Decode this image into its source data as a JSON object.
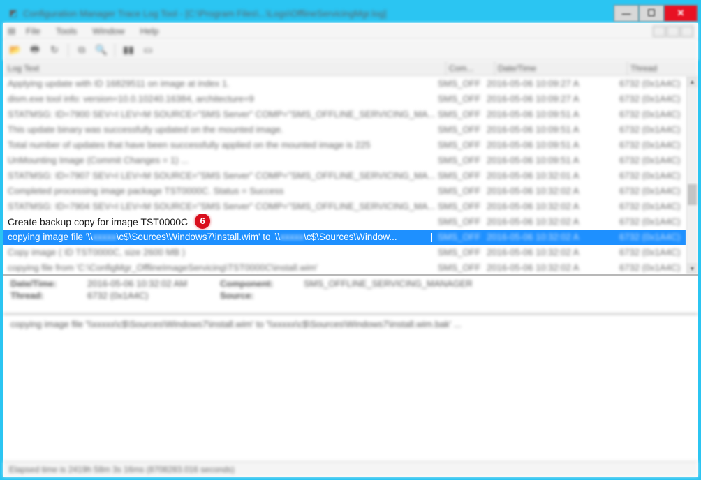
{
  "window": {
    "title": "Configuration Manager Trace Log Tool - [C:\\Program Files\\...\\Logs\\OfflineServicingMgr.log]"
  },
  "menu": {
    "file": "File",
    "tools": "Tools",
    "window": "Window",
    "help": "Help"
  },
  "columns": {
    "logtext": "Log Text",
    "comp": "Com...",
    "datetime": "Date/Time",
    "thread": "Thread"
  },
  "badge": "6",
  "rows": [
    {
      "text": "Applying update with ID 16829511 on image at index 1.",
      "comp": "SMS_OFF",
      "dt": "2016-05-06 10:09:27 A",
      "thread": "6732 (0x1A4C)",
      "cls": "blur"
    },
    {
      "text": "dism.exe tool info: version=10.0.10240.16384, architecture=9",
      "comp": "SMS_OFF",
      "dt": "2016-05-06 10:09:27 A",
      "thread": "6732 (0x1A4C)",
      "cls": "blur"
    },
    {
      "text": "STATMSG: ID=7900 SEV=I LEV=M SOURCE=\"SMS Server\" COMP=\"SMS_OFFLINE_SERVICING_MA...",
      "comp": "SMS_OFF",
      "dt": "2016-05-06 10:09:51 A",
      "thread": "6732 (0x1A4C)",
      "cls": "blur"
    },
    {
      "text": "This update binary was successfully updated on the mounted image.",
      "comp": "SMS_OFF",
      "dt": "2016-05-06 10:09:51 A",
      "thread": "6732 (0x1A4C)",
      "cls": "blur"
    },
    {
      "text": "Total number of updates that have been successfully applied on the mounted image is 225",
      "comp": "SMS_OFF",
      "dt": "2016-05-06 10:09:51 A",
      "thread": "6732 (0x1A4C)",
      "cls": "blur"
    },
    {
      "text": "UnMounting Image (Commit Changes = 1) ...",
      "comp": "SMS_OFF",
      "dt": "2016-05-06 10:09:51 A",
      "thread": "6732 (0x1A4C)",
      "cls": "blur"
    },
    {
      "text": "STATMSG: ID=7907 SEV=I LEV=M SOURCE=\"SMS Server\" COMP=\"SMS_OFFLINE_SERVICING_MA...",
      "comp": "SMS_OFF",
      "dt": "2016-05-06 10:32:01 A",
      "thread": "6732 (0x1A4C)",
      "cls": "blur"
    },
    {
      "text": "Completed processing image package TST0000C. Status = Success",
      "comp": "SMS_OFF",
      "dt": "2016-05-06 10:32:02 A",
      "thread": "6732 (0x1A4C)",
      "cls": "blur"
    },
    {
      "text": "STATMSG: ID=7904 SEV=I LEV=M SOURCE=\"SMS Server\" COMP=\"SMS_OFFLINE_SERVICING_MA...",
      "comp": "SMS_OFF",
      "dt": "2016-05-06 10:32:02 A",
      "thread": "6732 (0x1A4C)",
      "cls": "blur"
    },
    {
      "text": "Create backup copy for image TST0000C",
      "comp": "SMS_OFF",
      "dt": "2016-05-06 10:32:02 A",
      "thread": "6732 (0x1A4C)",
      "cls": "sharp1",
      "badge": true
    },
    {
      "text_parts": {
        "p1": "copying image file '\\\\",
        "srv1": "xxxxx",
        "p2": "\\c$\\Sources\\Windows7\\install.wim' to '\\\\",
        "srv2": "xxxxx",
        "p3": "\\c$\\Sources\\Window..."
      },
      "comp": "SMS_OFF",
      "dt": "2016-05-06 10:32:02 A",
      "thread": "6732 (0x1A4C)",
      "cls": "selected"
    },
    {
      "text": "Copy image ( ID TST0000C, size 2600 MB )",
      "comp": "SMS_OFF",
      "dt": "2016-05-06 10:32:02 A",
      "thread": "6732 (0x1A4C)",
      "cls": "blur"
    },
    {
      "text": "copying file from 'C:\\ConfigMgr_OfflineImageServicing\\TST0000C\\install.wim'",
      "comp": "SMS_OFF",
      "dt": "2016-05-06 10:32:02 A",
      "thread": "6732 (0x1A4C)",
      "cls": "blur"
    }
  ],
  "detail": {
    "datetime_lbl": "Date/Time:",
    "datetime": "2016-05-06 10:32:02 AM",
    "component_lbl": "Component:",
    "component": "SMS_OFFLINE_SERVICING_MANAGER",
    "thread_lbl": "Thread:",
    "thread": "6732 (0x1A4C)",
    "source_lbl": "Source:"
  },
  "message": "copying image file '\\\\xxxxx\\c$\\Sources\\Windows7\\install.wim' to '\\\\xxxxx\\c$\\Sources\\Windows7\\install.wim.bak' ...",
  "status": "Elapsed time is 2419h 58m 3s 16ms (8708283.016 seconds)"
}
